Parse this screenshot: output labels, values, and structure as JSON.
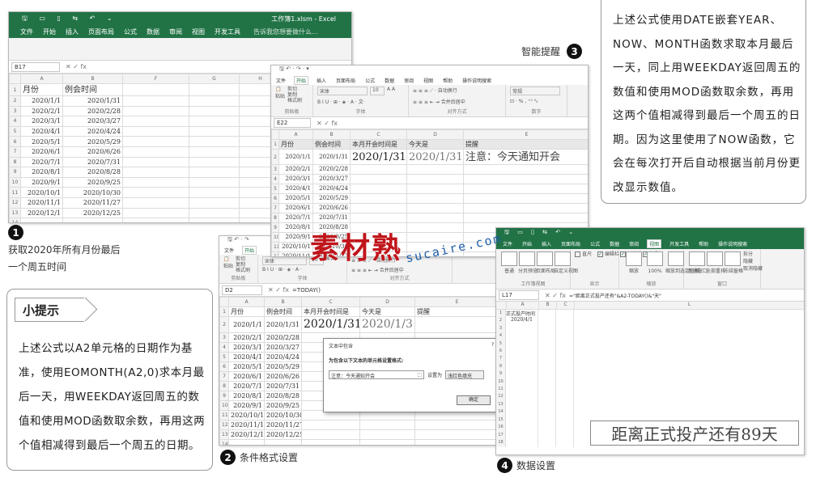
{
  "win1": {
    "title": "工作簿1.xlsm - Excel",
    "tabs": [
      "文件",
      "开始",
      "插入",
      "页面布局",
      "公式",
      "数据",
      "审阅",
      "视图",
      "开发工具"
    ],
    "search_hint": "告诉我您想要做什么...",
    "name_box": "B17",
    "col_headers": [
      "A",
      "B",
      "F",
      "G",
      "H",
      "I"
    ],
    "rows": [
      [
        "1",
        "月份",
        "例会时间"
      ],
      [
        "2",
        "2020/1/1",
        "2020/1/31"
      ],
      [
        "3",
        "2020/2/1",
        "2020/2/28"
      ],
      [
        "4",
        "2020/3/1",
        "2020/3/27"
      ],
      [
        "5",
        "2020/4/1",
        "2020/4/24"
      ],
      [
        "6",
        "2020/5/1",
        "2020/5/29"
      ],
      [
        "7",
        "2020/6/1",
        "2020/6/26"
      ],
      [
        "8",
        "2020/7/1",
        "2020/7/31"
      ],
      [
        "9",
        "2020/8/1",
        "2020/8/28"
      ],
      [
        "10",
        "2020/9/1",
        "2020/9/25"
      ],
      [
        "11",
        "2020/10/1",
        "2020/10/30"
      ],
      [
        "12",
        "2020/11/1",
        "2020/11/27"
      ],
      [
        "13",
        "2020/12/1",
        "2020/12/25"
      ],
      [
        "14",
        "",
        ""
      ]
    ]
  },
  "win2": {
    "tabs": [
      "文件",
      "开始",
      "插入",
      "页面布局",
      "公式",
      "数据",
      "审阅",
      "视图",
      "帮助",
      "操作说明搜索"
    ],
    "clipboard_items": [
      "剪切",
      "复制",
      "格式刷"
    ],
    "paste_label": "粘贴",
    "group_labels": [
      "剪贴板",
      "字体",
      "对齐方式",
      "数字"
    ],
    "font_value": "宋体",
    "font_size": "10",
    "wrap_label": "自动换行",
    "merge_label": "合并后居中",
    "number_format": "常规",
    "name_box": "E22",
    "col_headers": [
      "A",
      "B",
      "C",
      "D",
      "E"
    ],
    "header_row": [
      "1",
      "月份",
      "例会时间",
      "本月开会时间是",
      "今天是",
      "提醒"
    ],
    "row2": [
      "2",
      "2020/1/1",
      "2020/1/31",
      "2020/1/31",
      "2020/1/31",
      "注意：今天通知开会"
    ],
    "rows": [
      [
        "3",
        "2020/2/1",
        "2020/2/28"
      ],
      [
        "4",
        "2020/3/1",
        "2020/3/27"
      ],
      [
        "5",
        "2020/4/1",
        "2020/4/24"
      ],
      [
        "6",
        "2020/5/1",
        "2020/5/29"
      ],
      [
        "7",
        "2020/6/1",
        "2020/6/26"
      ],
      [
        "8",
        "2020/7/1",
        "2020/7/31"
      ],
      [
        "9",
        "2020/8/1",
        "2020/8/28"
      ],
      [
        "10",
        "2020/9/1",
        "2020/9/25"
      ],
      [
        "11",
        "2020/10/1",
        "2020/10/30"
      ],
      [
        "12",
        "2020/11/1",
        "2020/11/27"
      ],
      [
        "13",
        "2020/12/1",
        "2020/12/25"
      ]
    ]
  },
  "win3": {
    "tabs": [
      "文件",
      "开始"
    ],
    "name_box": "D2",
    "formula": "=TODAY()",
    "clipboard_items": [
      "剪切",
      "复制",
      "格式刷"
    ],
    "paste_label": "粘贴",
    "group_labels": [
      "剪贴板",
      "字体",
      "对齐方式"
    ],
    "font_value": "宋体",
    "font_size": "20",
    "wrap_label": "自动换行",
    "merge_label": "合并后居中",
    "col_headers": [
      "A",
      "B",
      "C",
      "D",
      "E"
    ],
    "header_row": [
      "1",
      "月份",
      "例会时间",
      "本月开会时间是",
      "今天是",
      "提醒"
    ],
    "row2": [
      "2",
      "2020/1/1",
      "2020/1/31",
      "2020/1/31",
      "2020/1/3"
    ],
    "rows": [
      [
        "3",
        "2020/2/1",
        "2020/2/28"
      ],
      [
        "4",
        "2020/3/1",
        "2020/3/27"
      ],
      [
        "5",
        "2020/4/1",
        "2020/4/24"
      ],
      [
        "6",
        "2020/5/1",
        "2020/5/29"
      ],
      [
        "7",
        "2020/6/1",
        "2020/6/26"
      ],
      [
        "8",
        "2020/7/1",
        "2020/7/31"
      ],
      [
        "9",
        "2020/8/1",
        "2020/8/28"
      ],
      [
        "10",
        "2020/9/1",
        "2020/9/25"
      ],
      [
        "11",
        "2020/10/1",
        "2020/10/30"
      ],
      [
        "12",
        "2020/11/1",
        "2020/11/27"
      ],
      [
        "13",
        "2020/12/1",
        "2020/12/25"
      ],
      [
        "14",
        "",
        ""
      ]
    ],
    "dialog": {
      "title": "文本中包含",
      "help": "?",
      "prompt": "为包含以下文本的单元格设置格式:",
      "input_value": "注意：今天通知开会",
      "setting_label": "设置为",
      "setting_value": "浅红色填充",
      "ok_label": "确定"
    }
  },
  "win4": {
    "tabs": [
      "文件",
      "开始",
      "插入",
      "页面布局",
      "公式",
      "数据",
      "审阅",
      "视图",
      "开发工具",
      "帮助",
      "操作说明搜索"
    ],
    "view_buttons": [
      "普通",
      "分页预览",
      "页面布局",
      "自定义视图"
    ],
    "show_items": [
      "直尺",
      "编辑栏",
      "网格线",
      "标题"
    ],
    "zoom_buttons": [
      "缩放",
      "100%",
      "缩放到选定区域"
    ],
    "window_buttons": [
      "新建窗口",
      "全部重排",
      "冻结窗格"
    ],
    "side_items": [
      "拆分",
      "隐藏",
      "取消隐藏"
    ],
    "group_labels": [
      "工作簿视图",
      "显示",
      "缩放",
      "窗口"
    ],
    "name_box": "L17",
    "formula": "=\"距离正式投产还有\"&A2-TODAY()&\"天\"",
    "col_headers": [
      "A",
      "B",
      "C",
      "L"
    ],
    "a1": "正式投产时间",
    "a2": "2020/4/1",
    "row_numbers": [
      "1",
      "2",
      "3",
      "4",
      "5",
      "6",
      "7",
      "8",
      "9",
      "10",
      "11",
      "12",
      "13",
      "14",
      "15",
      "16",
      "17",
      "18"
    ],
    "big_text": "距离正式投产还有89天"
  },
  "captions": {
    "c1_num": "1",
    "c1_text": "获取2020年所有月份最后一个周五时间",
    "c2_num": "2",
    "c2_text": "条件格式设置",
    "c3_num": "3",
    "c3_text": "智能提醒",
    "c4_num": "4",
    "c4_text": "数据设置"
  },
  "tip": {
    "title": "小提示",
    "body": "上述公式以A2单元格的日期作为基准，使用EOMONTH(A2,0)求本月最后一天，用WEEKDAY返回周五的数值和使用MOD函数取余数，再用这两个值相减得到最后一个周五的日期。"
  },
  "note": {
    "body": "上述公式使用DATE嵌套YEAR、NOW、MONTH函数求取本月最后一天，同上用WEEKDAY返回周五的数值和使用MOD函数取余数，再用这两个值相减得到最后一个周五的日期。因为这里使用了NOW函数，它会在每次打开后自动根据当前月份更改显示数值。"
  },
  "watermark": {
    "main": "素材熟",
    "sub": "sucaire.com",
    "colors": {
      "red": "#c0151b",
      "blue": "#1f5fa8"
    }
  }
}
